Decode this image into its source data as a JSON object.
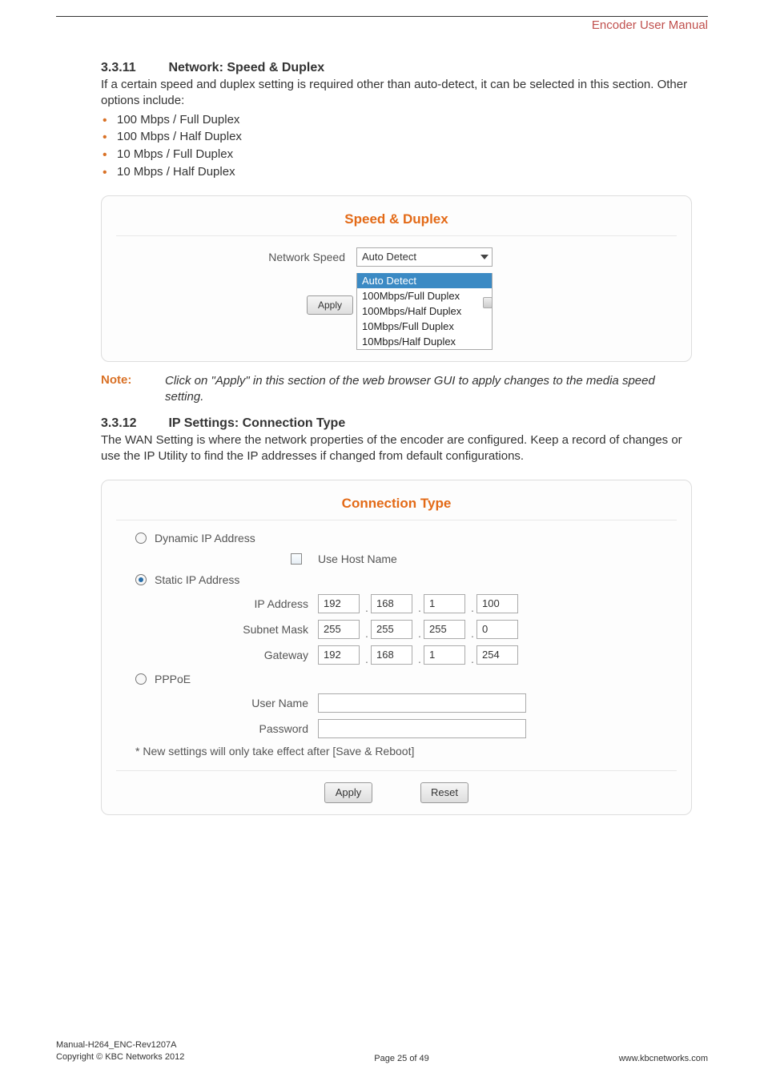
{
  "header": {
    "doc_title": "Encoder User Manual"
  },
  "sec1": {
    "number": "3.3.11",
    "title": "Network: Speed & Duplex",
    "intro": "If a certain speed and duplex setting is required other than auto-detect, it can be selected in this section. Other options include:",
    "bullets": [
      "100 Mbps / Full Duplex",
      "100 Mbps / Half Duplex",
      "10 Mbps / Full Duplex",
      "10 Mbps / Half Duplex"
    ]
  },
  "speed_panel": {
    "title": "Speed & Duplex",
    "label": "Network Speed",
    "selected": "Auto Detect",
    "options": [
      "Auto Detect",
      "100Mbps/Full Duplex",
      "100Mbps/Half Duplex",
      "10Mbps/Full Duplex",
      "10Mbps/Half Duplex"
    ],
    "apply": "Apply"
  },
  "note": {
    "label": "Note:",
    "text": "Click on \"Apply\" in this section of the web browser GUI to apply changes to the media speed setting."
  },
  "sec2": {
    "number": "3.3.12",
    "title": "IP Settings: Connection Type",
    "intro": "The WAN Setting is where the network properties of the encoder are configured. Keep a record of changes or use the IP Utility to find the IP addresses if changed from default configurations."
  },
  "conn_panel": {
    "title": "Connection Type",
    "dynamic_label": "Dynamic IP Address",
    "use_host_label": "Use Host Name",
    "static_label": "Static IP Address",
    "ip_label": "IP Address",
    "subnet_label": "Subnet Mask",
    "gateway_label": "Gateway",
    "pppoe_label": "PPPoE",
    "user_label": "User Name",
    "pass_label": "Password",
    "hint": "* New settings will only take effect after [Save & Reboot]",
    "ip": [
      "192",
      "168",
      "1",
      "100"
    ],
    "subnet": [
      "255",
      "255",
      "255",
      "0"
    ],
    "gateway": [
      "192",
      "168",
      "1",
      "254"
    ],
    "apply": "Apply",
    "reset": "Reset"
  },
  "footer": {
    "line1": "Manual-H264_ENC-Rev1207A",
    "line2": "Copyright © KBC Networks 2012",
    "center": "Page 25 of 49",
    "right": "www.kbcnetworks.com"
  }
}
